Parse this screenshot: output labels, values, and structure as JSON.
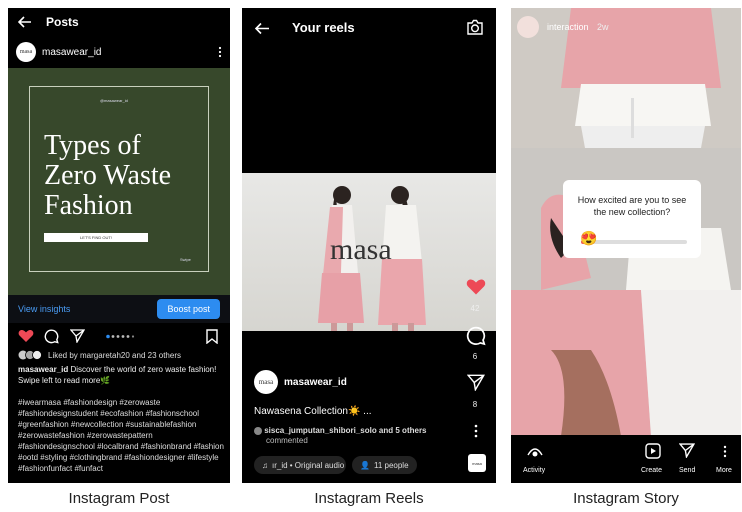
{
  "captions": [
    "Instagram Post",
    "Instagram Reels",
    "Instagram Story"
  ],
  "post": {
    "header_title": "Posts",
    "username": "masawear_id",
    "avatar_text": "masa",
    "image": {
      "handle": "@masawear_id",
      "title_lines": [
        "Types of",
        "Zero Waste",
        "Fashion"
      ],
      "button": "LET'S FIND OUT!",
      "swipe": "Swipe"
    },
    "view_insights": "View insights",
    "boost_post": "Boost post",
    "liked_by": "Liked by margaretah20 and 23 others",
    "caption_user": "masawear_id",
    "caption_text": "Discover the world of zero waste fashion! Swipe left to read more🌿",
    "hashtags": "#iwearmasa #fashiondesign #zerowaste #fashiondesignstudent #ecofashion #fashionschool #greenfashion #newcollection #sustainablefashion #zerowastefashion #zerowastepattern #fashiondesignschool #localbrand #fashionbrand #fashion #ootd #styling #clothingbrand #fashiondesigner #lifestyle #fashionfunfact #funfact"
  },
  "reels": {
    "header_title": "Your reels",
    "logo_text": "masa",
    "username": "masawear_id",
    "avatar_text": "masa",
    "title": "Nawasena Collection☀️ ...",
    "comment_line1": "sisca_jumputan_shibori_solo and 5 others",
    "comment_line2": "commented",
    "audio": "ır_id • Original audio",
    "people": "11 people",
    "likes": "42",
    "comments": "6",
    "shares": "8",
    "thumb_text": "masa"
  },
  "story": {
    "username": "interaction",
    "time": "2w",
    "poll_question": "How excited are you to see the new collection?",
    "emoji": "😍",
    "slider_fraction": 0.05,
    "bar": {
      "activity": "Activity",
      "create": "Create",
      "send": "Send",
      "more": "More"
    }
  },
  "colors": {
    "accent_blue": "#2d8cf0",
    "heart_red": "#ed4956",
    "post_green": "#37482b",
    "fabric_pink": "#e9a9ae"
  }
}
